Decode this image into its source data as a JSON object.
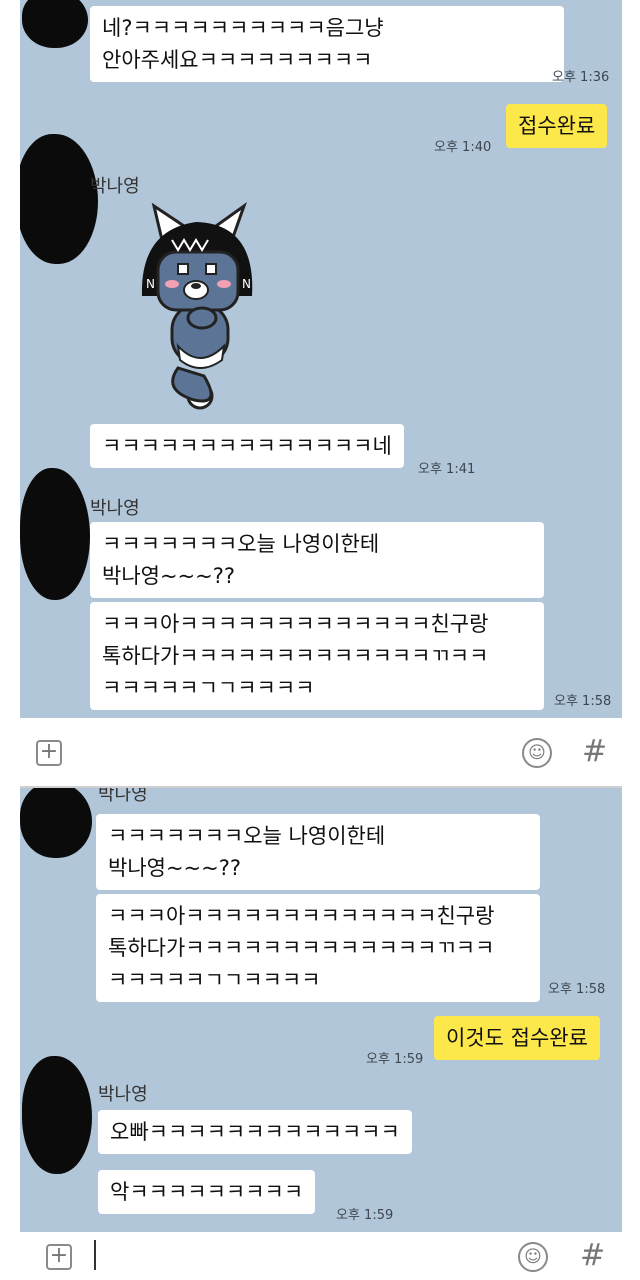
{
  "panel1": {
    "msg_ne": "네?ㅋㅋㅋㅋㅋㅋㅋㅋㅋㅋ음그냥\n안아주세요ㅋㅋㅋㅋㅋㅋㅋㅋㅋ",
    "time_136": "오후 1:36",
    "msg_receipt": "접수완료",
    "time_140": "오후 1:40",
    "sender1": "박나영",
    "sticker": "cat-mask-sticker",
    "msg_kkk_ne": "ㅋㅋㅋㅋㅋㅋㅋㅋㅋㅋㅋㅋㅋㅋ네",
    "time_141": "오후 1:41",
    "sender2": "박나영",
    "msg_today": "ㅋㅋㅋㅋㅋㅋㅋ오늘 나영이한테\n박나영~~~??",
    "msg_friend": "ㅋㅋㅋ아ㅋㅋㅋㅋㅋㅋㅋㅋㅋㅋㅋㅋㅋ친구랑\n톡하다가ㅋㅋㅋㅋㅋㅋㅋㅋㅋㅋㅋㅋㅋㄲㅋㅋ\nㅋㅋㅋㅋㅋㄱㄱㅋㅋㅋㅋ",
    "time_158": "오후 1:58"
  },
  "input1": {
    "plus": "+",
    "emoji": "☺",
    "hash": "#"
  },
  "panel2": {
    "sender_top": "박나영",
    "msg_today": "ㅋㅋㅋㅋㅋㅋㅋ오늘 나영이한테\n박나영~~~??",
    "msg_friend": "ㅋㅋㅋ아ㅋㅋㅋㅋㅋㅋㅋㅋㅋㅋㅋㅋㅋ친구랑\n톡하다가ㅋㅋㅋㅋㅋㅋㅋㅋㅋㅋㅋㅋㅋㄲㅋㅋ\nㅋㅋㅋㅋㅋㄱㄱㅋㅋㅋㅋ",
    "time_158": "오후 1:58",
    "msg_receipt2": "이것도 접수완료",
    "time_159a": "오후 1:59",
    "sender3": "박나영",
    "msg_oppa": "오빠ㅋㅋㅋㅋㅋㅋㅋㅋㅋㅋㅋㅋㅋ",
    "msg_ak": "악ㅋㅋㅋㅋㅋㅋㅋㅋㅋ",
    "time_159b": "오후 1:59"
  },
  "input2": {
    "plus": "+",
    "emoji": "☺",
    "hash": "#"
  },
  "colors": {
    "chat_bg": "#b2c6d9",
    "my_bubble": "#fde84c",
    "their_bubble": "#ffffff"
  }
}
